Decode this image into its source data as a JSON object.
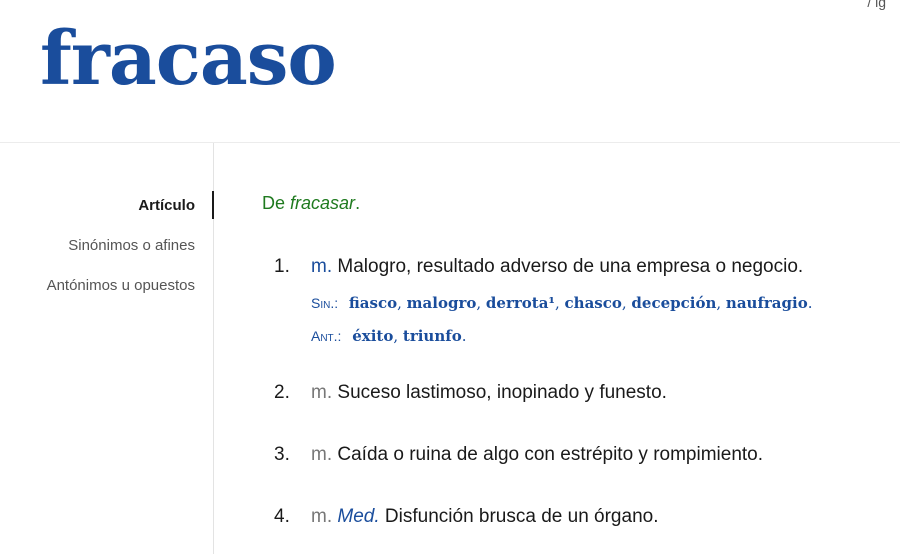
{
  "top_corner_text": "/ ig",
  "headword": "fracaso",
  "sidebar": {
    "items": [
      {
        "label": "Artículo",
        "active": true
      },
      {
        "label": "Sinónimos o afines",
        "active": false
      },
      {
        "label": "Antónimos u opuestos",
        "active": false
      }
    ]
  },
  "etymology": {
    "prefix": "De",
    "word": "fracasar",
    "suffix": "."
  },
  "senses": [
    {
      "number": "1.",
      "category": "m.",
      "domain": "",
      "definition": "Malogro, resultado adverso de una empresa o negocio.",
      "synonyms_label": "Sin.:",
      "synonyms": [
        "fiasco",
        "malogro",
        "derrota¹",
        "chasco",
        "decepción",
        "naufragio"
      ],
      "antonyms_label": "Ant.:",
      "antonyms": [
        "éxito",
        "triunfo"
      ]
    },
    {
      "number": "2.",
      "category": "m.",
      "domain": "",
      "definition": "Suceso lastimoso, inopinado y funesto."
    },
    {
      "number": "3.",
      "category": "m.",
      "domain": "",
      "definition": "Caída o ruina de algo con estrépito y rompimiento."
    },
    {
      "number": "4.",
      "category": "m.",
      "domain": "Med.",
      "definition": "Disfunción brusca de un órgano."
    }
  ],
  "colors": {
    "headword": "#1a4d9c",
    "etymology": "#1f7a1f",
    "links": "#1a4d9c"
  }
}
